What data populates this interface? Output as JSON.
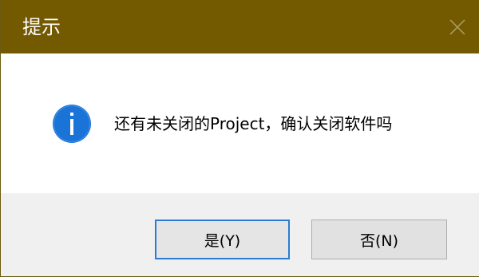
{
  "window": {
    "title": "提示",
    "close_icon": "close-icon",
    "titlebar_color": "#735900"
  },
  "content": {
    "icon": "info-icon",
    "icon_color": "#1a73d6",
    "message": "还有未关闭的Project，确认关闭软件吗"
  },
  "buttons": {
    "yes_label": "是(Y)",
    "no_label": "否(N)",
    "focus_color": "#2b7cd3"
  }
}
